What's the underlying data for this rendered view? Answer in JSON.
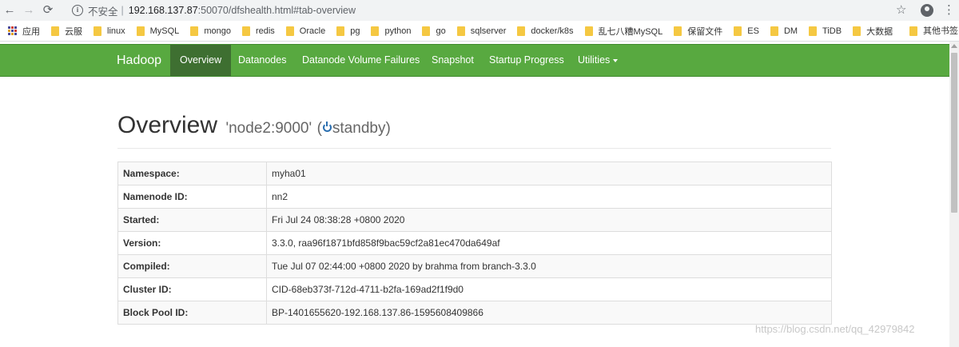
{
  "browser": {
    "insecure_label": "不安全",
    "url_host": "192.168.137.87",
    "url_rest": ":50070/dfshealth.html#tab-overview",
    "apps_label": "应用",
    "bookmarks": [
      "云服",
      "linux",
      "MySQL",
      "mongo",
      "redis",
      "Oracle",
      "pg",
      "python",
      "go",
      "sqlserver",
      "docker/k8s",
      "乱七八糟MySQL",
      "保留文件",
      "ES",
      "DM",
      "TiDB",
      "大数据"
    ],
    "other_bookmarks": "其他书签"
  },
  "nav": {
    "brand": "Hadoop",
    "items": [
      "Overview",
      "Datanodes",
      "Datanode Volume Failures",
      "Snapshot",
      "Startup Progress",
      "Utilities"
    ],
    "active": "Overview",
    "color": "#58a940"
  },
  "overview": {
    "title": "Overview",
    "node": "'node2:9000'",
    "state_prefix": "(",
    "state": "standby)",
    "rows": [
      {
        "key": "Namespace:",
        "value": "myha01"
      },
      {
        "key": "Namenode ID:",
        "value": "nn2"
      },
      {
        "key": "Started:",
        "value": "Fri Jul 24 08:38:28 +0800 2020"
      },
      {
        "key": "Version:",
        "value": "3.3.0, raa96f1871bfd858f9bac59cf2a81ec470da649af"
      },
      {
        "key": "Compiled:",
        "value": "Tue Jul 07 02:44:00 +0800 2020 by brahma from branch-3.3.0"
      },
      {
        "key": "Cluster ID:",
        "value": "CID-68eb373f-712d-4711-b2fa-169ad2f1f9d0"
      },
      {
        "key": "Block Pool ID:",
        "value": "BP-1401655620-192.168.137.86-1595608409866"
      }
    ]
  },
  "watermark": "https://blog.csdn.net/qq_42979842"
}
